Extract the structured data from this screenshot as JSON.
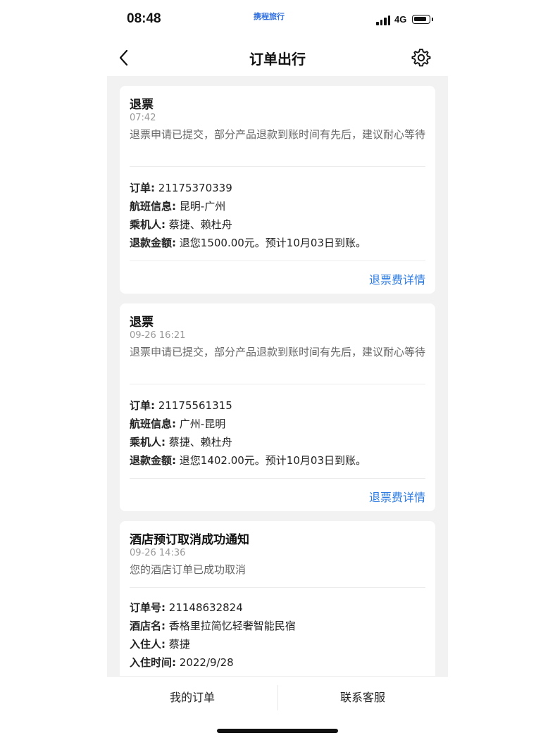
{
  "status_bar": {
    "time": "08:48",
    "brand": "携程旅行",
    "network": "4G"
  },
  "nav": {
    "title": "订单出行",
    "back_icon": "chevron-left-icon",
    "settings_icon": "gear-icon"
  },
  "cards": [
    {
      "title": "退票",
      "time": "07:42",
      "message": "退票申请已提交，部分产品退款到账时间有先后，建议耐心等待",
      "details": [
        {
          "label": "订单:",
          "value": "21175370339"
        },
        {
          "label": "航班信息:",
          "value": "昆明-广州"
        },
        {
          "label": "乘机人:",
          "value": "蔡捷、赖杜舟"
        },
        {
          "label": "退款金额:",
          "value": "退您1500.00元。预计10月03日到账。"
        }
      ],
      "link": "退票费详情"
    },
    {
      "title": "退票",
      "time": "09-26 16:21",
      "message": "退票申请已提交，部分产品退款到账时间有先后，建议耐心等待",
      "details": [
        {
          "label": "订单:",
          "value": "21175561315"
        },
        {
          "label": "航班信息:",
          "value": "广州-昆明"
        },
        {
          "label": "乘机人:",
          "value": "蔡捷、赖杜舟"
        },
        {
          "label": "退款金额:",
          "value": "退您1402.00元。预计10月03日到账。"
        }
      ],
      "link": "退票费详情"
    },
    {
      "title": "酒店预订取消成功通知",
      "time": "09-26 14:36",
      "message": "您的酒店订单已成功取消",
      "details": [
        {
          "label": "订单号:",
          "value": "21148632824"
        },
        {
          "label": "酒店名:",
          "value": "香格里拉简忆轻奢智能民宿"
        },
        {
          "label": "入住人:",
          "value": "蔡捷"
        },
        {
          "label": "入住时间:",
          "value": "2022/9/28"
        }
      ]
    }
  ],
  "bottom_bar": {
    "my_orders": "我的订单",
    "contact_service": "联系客服"
  },
  "colors": {
    "link": "#2a7ae2",
    "background": "#f2f2f2"
  }
}
